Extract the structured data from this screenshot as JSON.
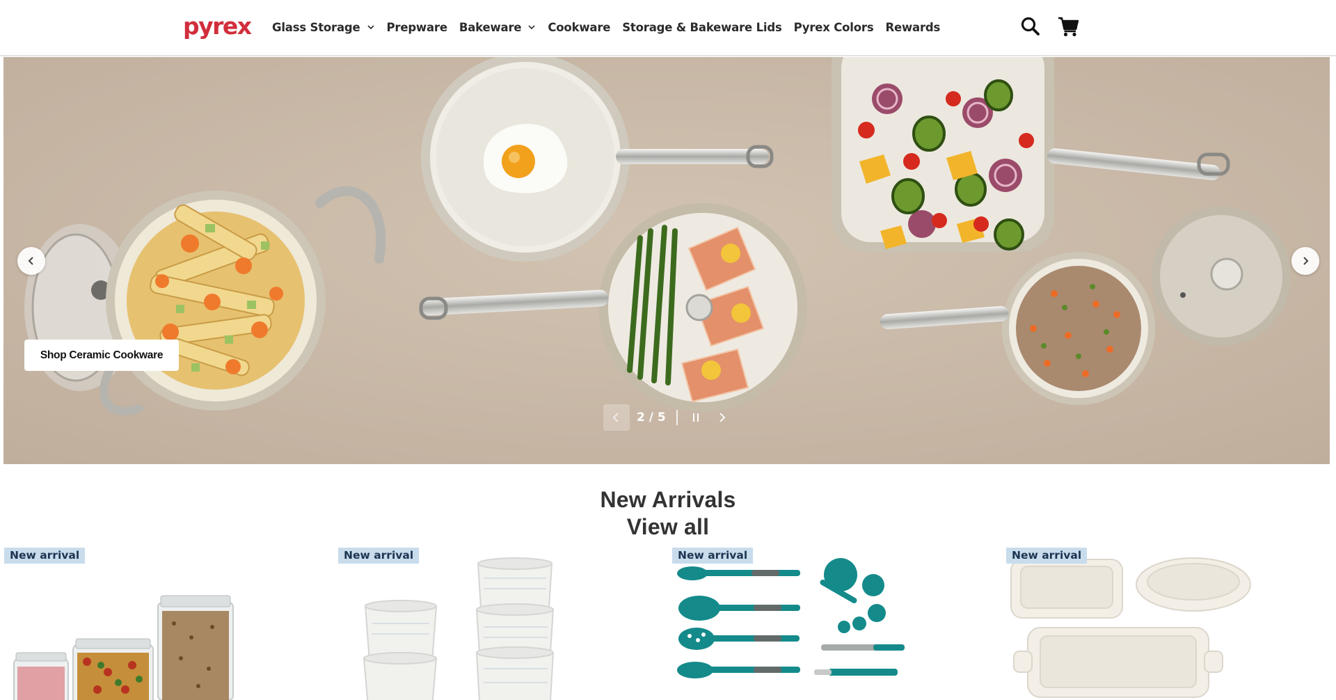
{
  "brand": {
    "logo_text": "pyrex",
    "logo_color": "#d12e3c"
  },
  "nav": {
    "items": [
      {
        "label": "Glass Storage",
        "has_dropdown": true
      },
      {
        "label": "Prepware",
        "has_dropdown": false
      },
      {
        "label": "Bakeware",
        "has_dropdown": true
      },
      {
        "label": "Cookware",
        "has_dropdown": false
      },
      {
        "label": "Storage & Bakeware Lids",
        "has_dropdown": false
      },
      {
        "label": "Pyrex Colors",
        "has_dropdown": false
      },
      {
        "label": "Rewards",
        "has_dropdown": false
      }
    ]
  },
  "header_icons": {
    "search": "search-icon",
    "cart": "cart-icon"
  },
  "hero": {
    "cta_label": "Shop Ceramic Cookware",
    "slide_counter": "2 / 5",
    "current_slide": 2,
    "total_slides": 5,
    "background_color": "#c9b9a8"
  },
  "new_arrivals": {
    "title": "New Arrivals",
    "view_all": "View all",
    "products": [
      {
        "badge": "New arrival",
        "image": "glass-storage-canisters"
      },
      {
        "badge": "New arrival",
        "image": "ceramic-ramekins"
      },
      {
        "badge": "New arrival",
        "image": "teal-kitchen-utensils"
      },
      {
        "badge": "New arrival",
        "image": "cream-bakeware-set"
      }
    ],
    "badge_color": "#c8dcec"
  }
}
